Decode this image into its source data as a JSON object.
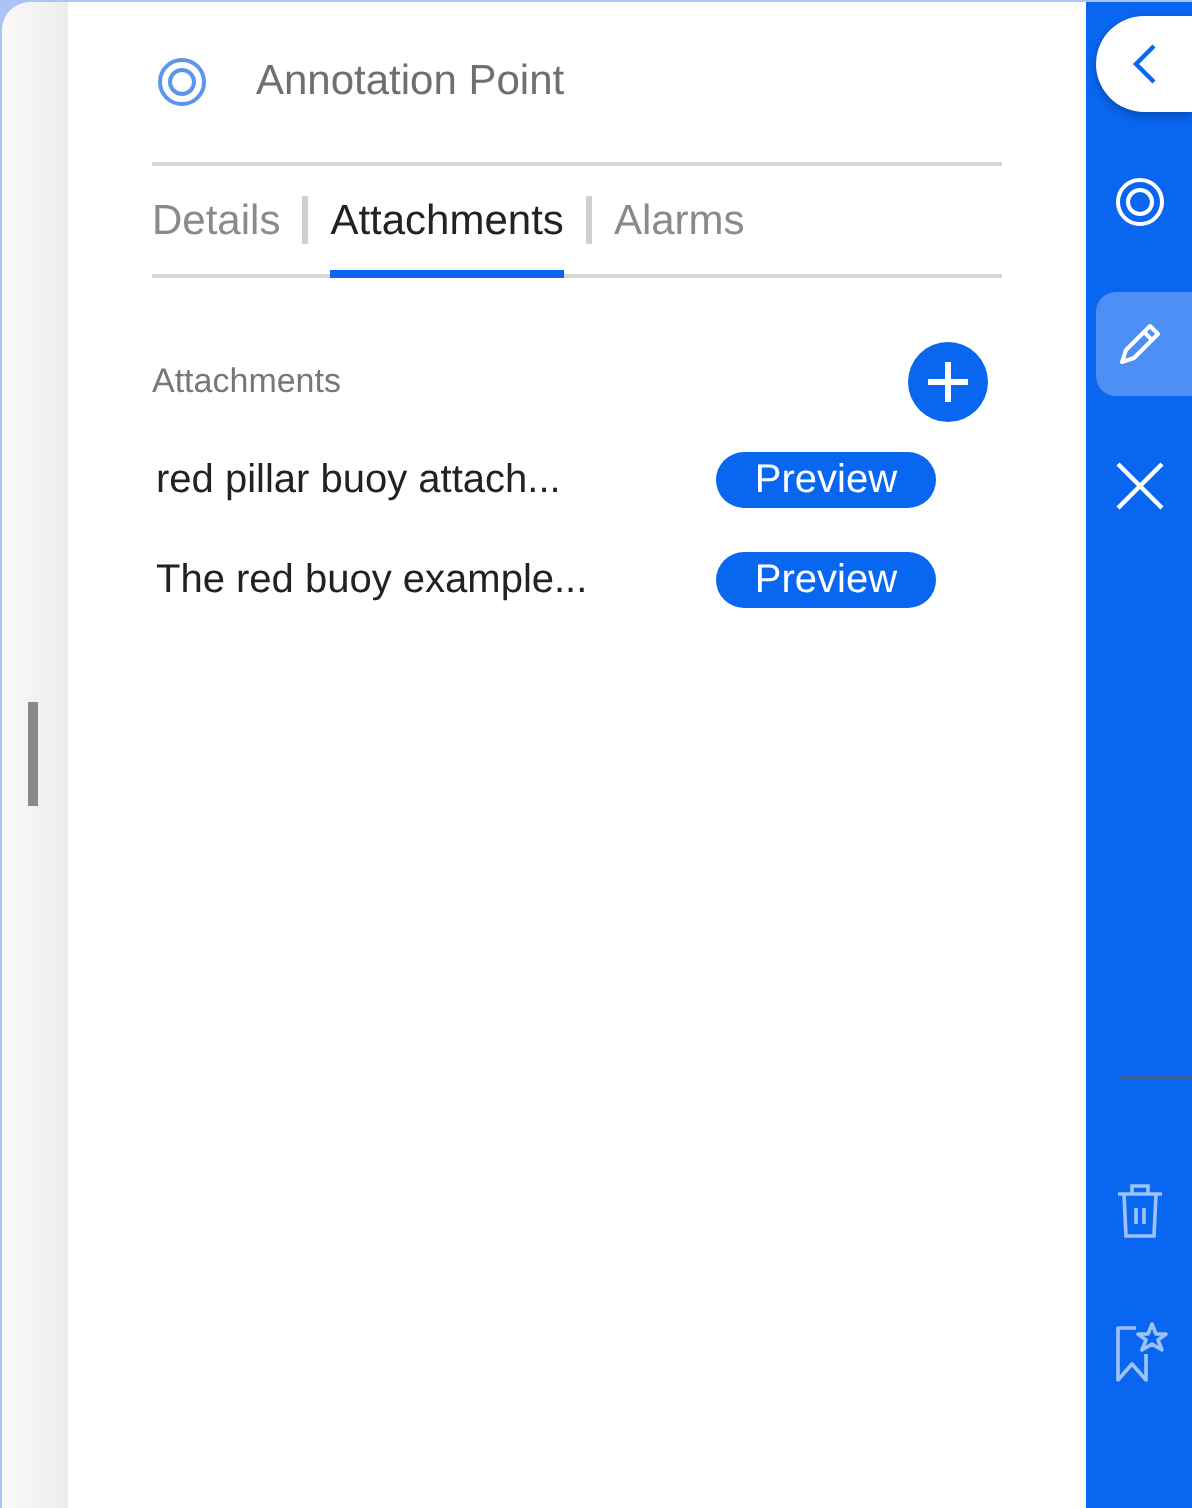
{
  "panel": {
    "title": "Annotation Point"
  },
  "tabs": [
    {
      "label": "Details",
      "selected": false
    },
    {
      "label": "Attachments",
      "selected": true
    },
    {
      "label": "Alarms",
      "selected": false
    }
  ],
  "attachments": {
    "heading": "Attachments",
    "items": [
      {
        "name": "red pillar buoy attach...",
        "action": "Preview"
      },
      {
        "name": "The red buoy example...",
        "action": "Preview"
      }
    ]
  },
  "rail": {
    "top": [
      {
        "kind": "target",
        "selected": false
      },
      {
        "kind": "pencil",
        "selected": true
      },
      {
        "kind": "close",
        "selected": false
      }
    ],
    "bottom": [
      {
        "kind": "trash",
        "selected": false
      },
      {
        "kind": "bookmark-star",
        "selected": false
      }
    ]
  }
}
